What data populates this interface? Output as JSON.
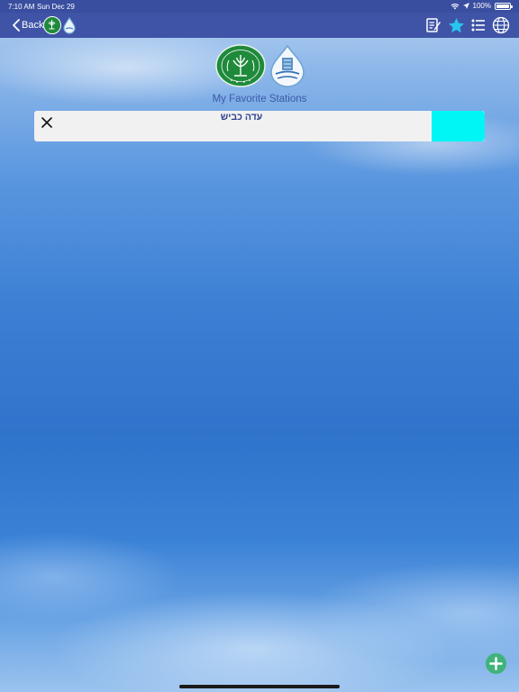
{
  "status_bar": {
    "time": "7:10 AM",
    "date": "Sun Dec 29",
    "battery": "100%",
    "battery_level": 1.0
  },
  "nav": {
    "back_label": "Back",
    "icons": [
      "edit-icon",
      "star-icon",
      "list-icon",
      "globe-icon"
    ]
  },
  "header": {
    "title": "My Favorite Stations"
  },
  "stations": [
    {
      "name": "עדה כביש",
      "status_color": "#00f5f5"
    }
  ],
  "colors": {
    "nav_bg": "#3f54a6",
    "accent_star": "#29c4f0",
    "title": "#3a5ba8",
    "add_button": "#3fb37a"
  }
}
